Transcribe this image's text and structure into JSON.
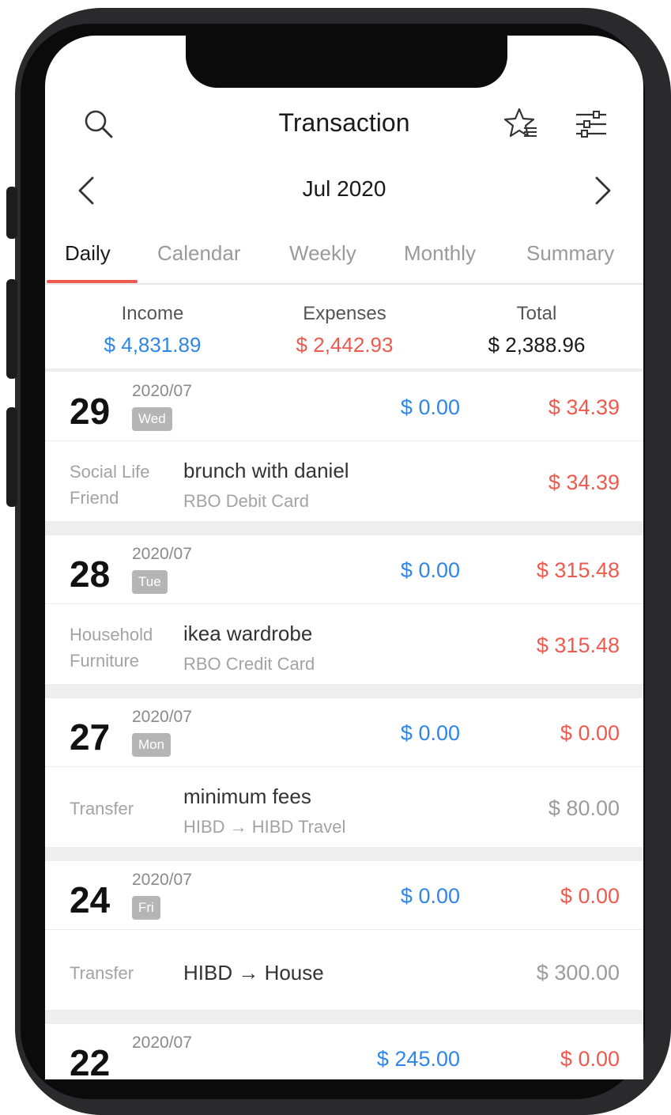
{
  "header": {
    "title": "Transaction",
    "month": "Jul 2020"
  },
  "icons": {
    "search": "search-icon",
    "favorites": "star-list-icon",
    "filter": "sliders-icon",
    "prev": "chevron-left-icon",
    "next": "chevron-right-icon"
  },
  "tabs": [
    {
      "label": "Daily",
      "active": true
    },
    {
      "label": "Calendar",
      "active": false
    },
    {
      "label": "Weekly",
      "active": false
    },
    {
      "label": "Monthly",
      "active": false
    },
    {
      "label": "Summary",
      "active": false
    }
  ],
  "summary": {
    "income_label": "Income",
    "income": "$ 4,831.89",
    "expenses_label": "Expenses",
    "expenses": "$ 2,442.93",
    "total_label": "Total",
    "total": "$ 2,388.96"
  },
  "days": [
    {
      "day": "29",
      "ym": "2020/07",
      "weekday": "Wed",
      "income": "$ 0.00",
      "expense": "$ 34.39",
      "entries": [
        {
          "category": "Social Life",
          "subcategory": "Friend",
          "note": "brunch with daniel",
          "account": "RBO Debit Card",
          "amount": "$ 34.39"
        }
      ]
    },
    {
      "day": "28",
      "ym": "2020/07",
      "weekday": "Tue",
      "income": "$ 0.00",
      "expense": "$ 315.48",
      "entries": [
        {
          "category": "Household",
          "subcategory": "Furniture",
          "note": "ikea wardrobe",
          "account": "RBO Credit Card",
          "amount": "$ 315.48"
        }
      ]
    },
    {
      "day": "27",
      "ym": "2020/07",
      "weekday": "Mon",
      "income": "$ 0.00",
      "expense": "$ 0.00",
      "entries": [
        {
          "category": "Transfer",
          "subcategory": "",
          "note": "minimum fees",
          "account": "HIBD → HIBD Travel",
          "amount": "$ 80.00"
        }
      ]
    },
    {
      "day": "24",
      "ym": "2020/07",
      "weekday": "Fri",
      "income": "$ 0.00",
      "expense": "$ 0.00",
      "entries": [
        {
          "category": "Transfer",
          "subcategory": "",
          "note": "HIBD → House",
          "account": "",
          "amount": "$ 300.00"
        }
      ]
    },
    {
      "day": "22",
      "ym": "2020/07",
      "weekday": "",
      "income": "$ 245.00",
      "expense": "$ 0.00",
      "entries": []
    }
  ]
}
